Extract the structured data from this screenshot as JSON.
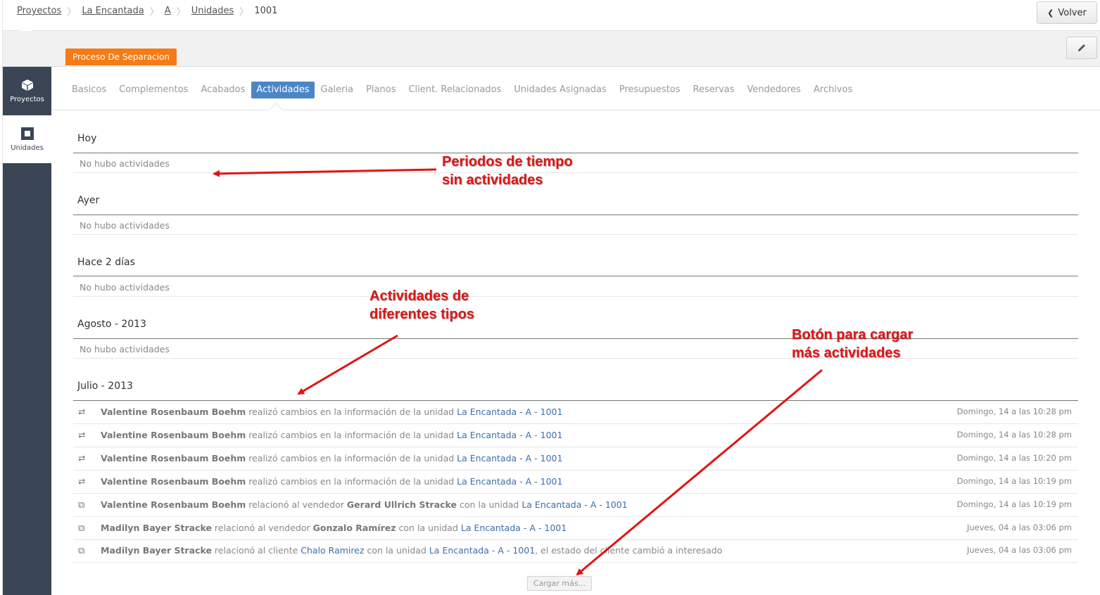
{
  "breadcrumb": {
    "items": [
      "Proyectos",
      "La Encantada",
      "A",
      "Unidades"
    ],
    "current": "1001"
  },
  "header": {
    "back_label": "Volver",
    "status_badge": "Proceso De Separacion",
    "edit_icon": "pencil-icon"
  },
  "sidebar": {
    "items": [
      {
        "label": "Proyectos",
        "icon": "cube-icon"
      },
      {
        "label": "Unidades",
        "icon": "square-icon"
      }
    ]
  },
  "tabs": {
    "items": [
      "Basicos",
      "Complementos",
      "Acabados",
      "Actividades",
      "Galeria",
      "Planos",
      "Client. Relacionados",
      "Unidades Asignadas",
      "Presupuestos",
      "Reservas",
      "Vendedores",
      "Archivos"
    ],
    "active": "Actividades"
  },
  "sections": [
    {
      "title": "Hoy",
      "empty": "No hubo actividades"
    },
    {
      "title": "Ayer",
      "empty": "No hubo actividades"
    },
    {
      "title": "Hace 2 días",
      "empty": "No hubo actividades"
    },
    {
      "title": "Agosto - 2013",
      "empty": "No hubo actividades"
    },
    {
      "title": "Julio - 2013"
    }
  ],
  "activities": [
    {
      "icon": "retweet-icon",
      "actor": "Valentine Rosenbaum Boehm",
      "verb": " realizó cambios en la información de la unidad ",
      "link": "La Encantada - A - 1001",
      "date": "Domingo, 14 a las 10:28 pm"
    },
    {
      "icon": "retweet-icon",
      "actor": "Valentine Rosenbaum Boehm",
      "verb": " realizó cambios en la información de la unidad ",
      "link": "La Encantada - A - 1001",
      "date": "Domingo, 14 a las 10:28 pm"
    },
    {
      "icon": "retweet-icon",
      "actor": "Valentine Rosenbaum Boehm",
      "verb": " realizó cambios en la información de la unidad ",
      "link": "La Encantada - A - 1001",
      "date": "Domingo, 14 a las 10:20 pm"
    },
    {
      "icon": "retweet-icon",
      "actor": "Valentine Rosenbaum Boehm",
      "verb": " realizó cambios en la información de la unidad ",
      "link": "La Encantada - A - 1001",
      "date": "Domingo, 14 a las 10:19 pm"
    },
    {
      "icon": "relation-icon",
      "actor": "Valentine Rosenbaum Boehm",
      "verb": " relacionó al vendedor ",
      "target": "Gerard Ullrich Stracke",
      "verb2": " con la unidad ",
      "link": "La Encantada - A - 1001",
      "date": "Domingo, 14 a las 10:19 pm"
    },
    {
      "icon": "relation-icon",
      "actor": "Madilyn Bayer Stracke",
      "verb": " relacionó al vendedor ",
      "target": "Gonzalo Ramírez",
      "verb2": " con la unidad ",
      "link": "La Encantada - A - 1001",
      "date": "Jueves, 04 a las 03:06 pm"
    },
    {
      "icon": "relation-icon",
      "actor": "Madilyn Bayer Stracke",
      "verb": " relacionó al cliente ",
      "client": "Chalo Ramirez",
      "verb2": " con la unidad ",
      "link": "La Encantada - A - 1001",
      "tail": ", el estado del cliente cambió a interesado",
      "date": "Jueves, 04 a las 03:06 pm"
    }
  ],
  "load_more_label": "Cargar más...",
  "annotations": {
    "a1": [
      "Periodos de tiempo",
      "sin actividades"
    ],
    "a2": [
      "Actividades de",
      "diferentes tipos"
    ],
    "a3": [
      "Botón para cargar",
      "más actividades"
    ]
  },
  "colors": {
    "accent": "#4a86c5",
    "badge": "#f47b16",
    "sidebar": "#3a4556",
    "annotation": "#e01414"
  }
}
